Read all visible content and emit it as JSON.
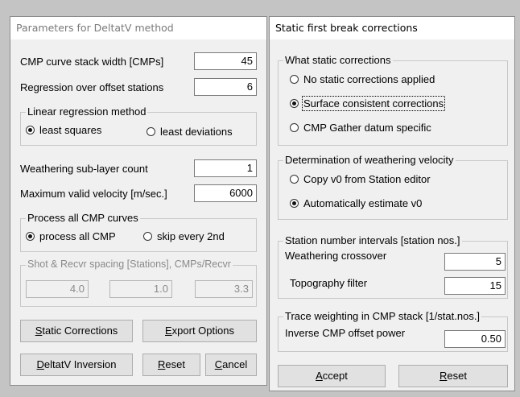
{
  "left": {
    "title": "Parameters for DeltatV method",
    "cmp_stack_width": {
      "label": "CMP curve stack width [CMPs]",
      "value": "45"
    },
    "regression_offset": {
      "label": "Regression over offset stations",
      "value": "6"
    },
    "regression_method": {
      "legend": "Linear regression method",
      "opt1": "least squares",
      "opt2": "least deviations",
      "selected": "least squares"
    },
    "sublayer_count": {
      "label": "Weathering sub-layer count",
      "value": "1"
    },
    "max_velocity": {
      "label": "Maximum valid velocity [m/sec.]",
      "value": "6000"
    },
    "process_curves": {
      "legend": "Process all CMP curves",
      "opt1": "process all CMP",
      "opt2": "skip every 2nd",
      "selected": "process all CMP"
    },
    "spacing": {
      "legend": "Shot & Recvr spacing [Stations], CMPs/Recvr",
      "values": [
        "4.0",
        "1.0",
        "3.3"
      ]
    },
    "buttons": {
      "static_pre": "",
      "static_u": "S",
      "static_post": "tatic Corrections",
      "export_pre": "",
      "export_u": "E",
      "export_post": "xport Options",
      "inv_pre": "",
      "inv_u": "D",
      "inv_post": "eltatV Inversion",
      "reset_pre": "",
      "reset_u": "R",
      "reset_post": "eset",
      "cancel_pre": "",
      "cancel_u": "C",
      "cancel_post": "ancel"
    }
  },
  "right": {
    "title": "Static first break corrections",
    "what_static": {
      "legend": "What static corrections",
      "opt1": "No static corrections applied",
      "opt2": "Surface consistent corrections",
      "opt3": "CMP Gather datum specific",
      "selected": "Surface consistent corrections"
    },
    "weathering_velocity": {
      "legend": "Determination of weathering velocity",
      "opt1": "Copy v0 from Station editor",
      "opt2": "Automatically estimate v0",
      "selected": "Automatically estimate v0"
    },
    "intervals": {
      "legend": "Station number intervals [station nos.]",
      "crossover_label": "Weathering crossover",
      "crossover_value": "5",
      "topo_label": "Topography filter",
      "topo_value": "15"
    },
    "trace_weighting": {
      "legend": "Trace weighting in CMP stack [1/stat.nos.]",
      "label": "Inverse CMP offset power",
      "value": "0.50"
    },
    "buttons": {
      "accept_pre": "",
      "accept_u": "A",
      "accept_post": "ccept",
      "reset_pre": "",
      "reset_u": "R",
      "reset_post": "eset"
    }
  }
}
